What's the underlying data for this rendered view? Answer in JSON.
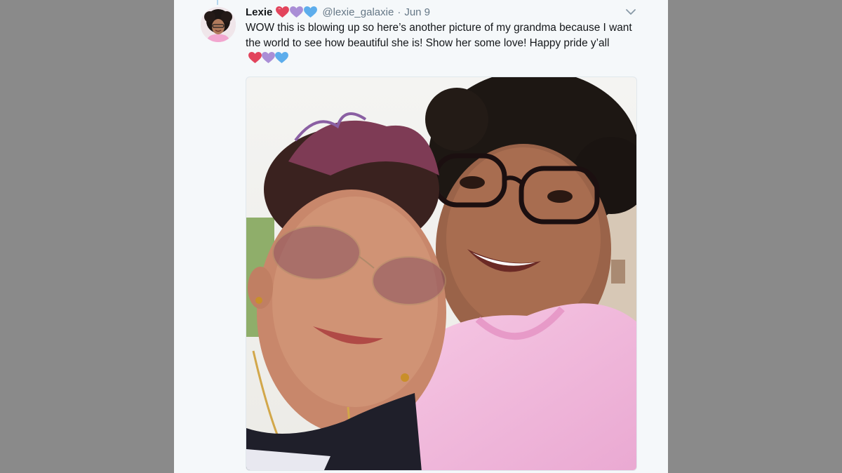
{
  "tweet": {
    "author_name": "Lexie",
    "author_emojis": [
      "red-heart",
      "purple-heart",
      "blue-heart"
    ],
    "handle": "@lexie_galaxie",
    "separator": "·",
    "date": "Jun 9",
    "text": "WOW this is blowing up so here’s another picture of my grandma because I want the world to see how beautiful she is! Show her some love! Happy pride y’all",
    "text_emojis": [
      "red-heart",
      "purple-heart",
      "blue-heart"
    ],
    "menu_icon": "chevron-down-icon",
    "media_icon": "photo"
  },
  "colors": {
    "page_background": "#8a8a8a",
    "panel_background": "#f5f8fa",
    "text_primary": "#14171a",
    "text_secondary": "#657786",
    "heart_red": "#e2445c",
    "heart_purple": "#aa8ed6",
    "heart_blue": "#5dadec"
  }
}
